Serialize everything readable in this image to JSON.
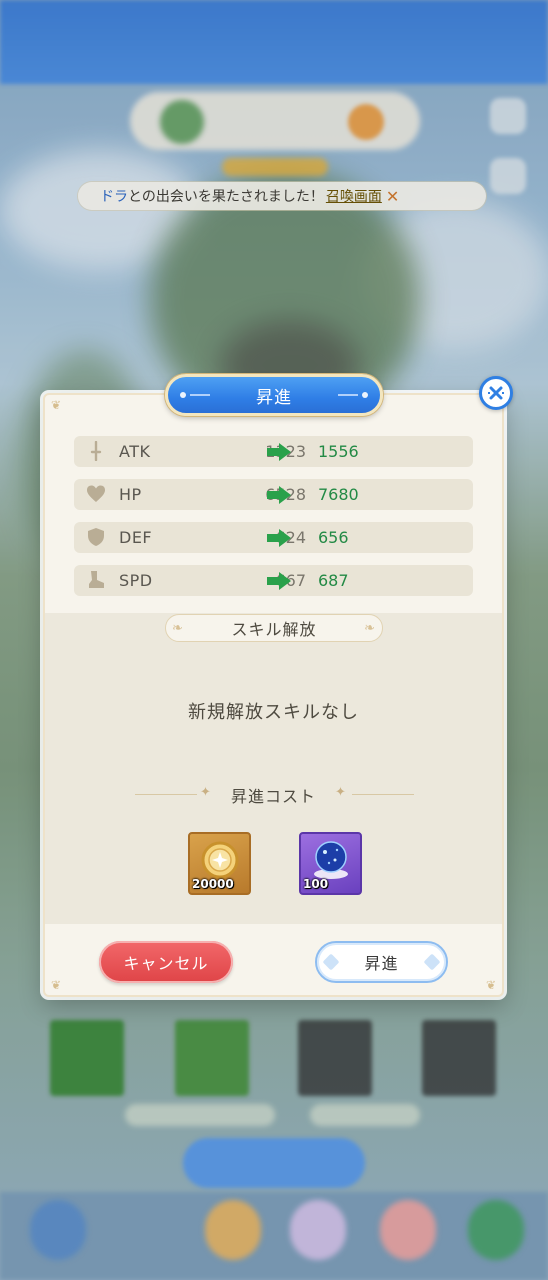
{
  "notification": {
    "highlight": "ドラ",
    "text": "との出会いを果たされました！",
    "link": "召喚画面",
    "close_glyph": "✕"
  },
  "modal": {
    "title": "昇進",
    "stats": [
      {
        "icon": "sword-icon",
        "name": "ATK",
        "before": "1323",
        "after": "1556"
      },
      {
        "icon": "heart-icon",
        "name": "HP",
        "before": "6528",
        "after": "7680"
      },
      {
        "icon": "shield-icon",
        "name": "DEF",
        "before": "624",
        "after": "656"
      },
      {
        "icon": "boot-icon",
        "name": "SPD",
        "before": "667",
        "after": "687"
      }
    ],
    "skill_section_title": "スキル解放",
    "no_skill_text": "新規解放スキルなし",
    "cost_title": "昇進コスト",
    "cost_items": [
      {
        "icon": "gold-coin-icon",
        "quantity": "20000"
      },
      {
        "icon": "crystal-orb-icon",
        "quantity": "100"
      }
    ],
    "cancel_label": "キャンセル",
    "confirm_label": "昇進"
  },
  "colors": {
    "accent_blue": "#2f7ee6",
    "cancel_red": "#df4447",
    "increase_green": "#238a45",
    "panel": "#f7f4ec"
  }
}
